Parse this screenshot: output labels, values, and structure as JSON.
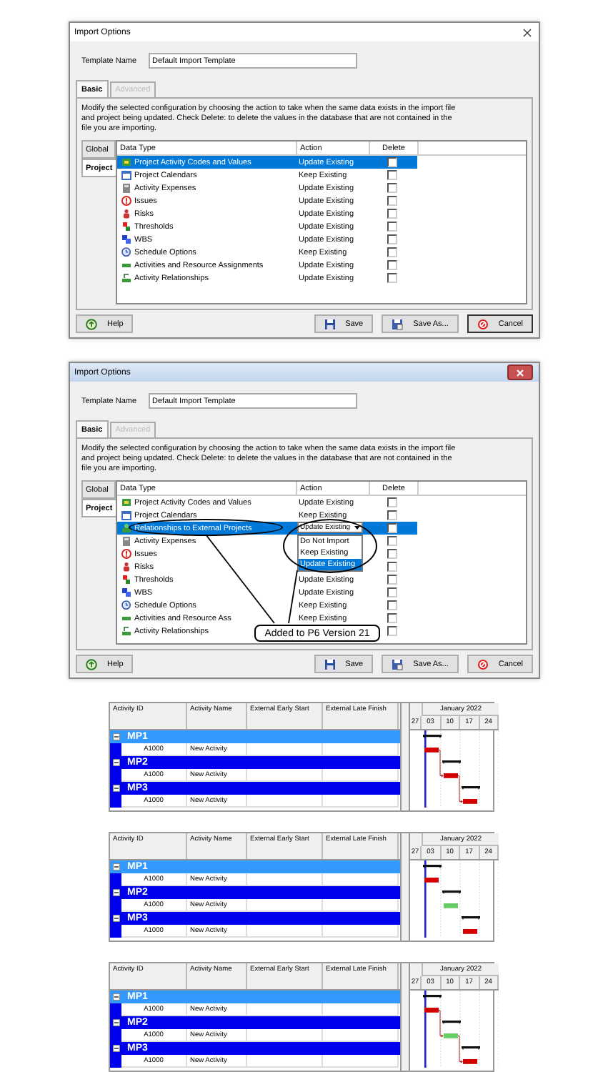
{
  "dialogs": [
    {
      "title": "Import Options",
      "kind": "win10",
      "template_label": "Template Name",
      "template_value": "Default Import Template",
      "tabs": [
        {
          "label": "Basic",
          "selected": true,
          "disabled": false
        },
        {
          "label": "Advanced",
          "selected": false,
          "disabled": true
        }
      ],
      "description": "Modify the selected configuration by choosing the action to take when the same data exists in the import file and project being updated. Check Delete: to delete the values in the database that are not contained in the file you are importing.",
      "side_tabs": [
        {
          "label": "Global",
          "selected": false
        },
        {
          "label": "Project",
          "selected": true
        }
      ],
      "columns": [
        "Data Type",
        "Action",
        "Delete"
      ],
      "rows": [
        {
          "kind": "codes",
          "name": "Project Activity Codes and Values",
          "action": "Update Existing",
          "delete": false,
          "selected": true
        },
        {
          "kind": "calendar",
          "name": "Project Calendars",
          "action": "Keep Existing",
          "delete": false,
          "selected": false
        },
        {
          "kind": "expenses",
          "name": "Activity Expenses",
          "action": "Update Existing",
          "delete": false,
          "selected": false
        },
        {
          "kind": "issues",
          "name": "Issues",
          "action": "Update Existing",
          "delete": false,
          "selected": false
        },
        {
          "kind": "risks",
          "name": "Risks",
          "action": "Update Existing",
          "delete": false,
          "selected": false
        },
        {
          "kind": "thresholds",
          "name": "Thresholds",
          "action": "Update Existing",
          "delete": false,
          "selected": false
        },
        {
          "kind": "wbs",
          "name": "WBS",
          "action": "Update Existing",
          "delete": false,
          "selected": false
        },
        {
          "kind": "schedule",
          "name": "Schedule Options",
          "action": "Keep Existing",
          "delete": false,
          "selected": false
        },
        {
          "kind": "assignments",
          "name": "Activities and Resource Assignments",
          "action": "Update Existing",
          "delete": false,
          "selected": false
        },
        {
          "kind": "relationships",
          "name": "Activity Relationships",
          "action": "Update Existing",
          "delete": false,
          "selected": false
        }
      ],
      "buttons": [
        {
          "kind": "help",
          "label": "Help",
          "default": false
        },
        {
          "kind": "save",
          "label": "Save",
          "default": false
        },
        {
          "kind": "save_as",
          "label": "Save As...",
          "default": false
        },
        {
          "kind": "cancel",
          "label": "Cancel",
          "default": true
        }
      ]
    },
    {
      "title": "Import Options",
      "kind": "win7",
      "template_label": "Template Name",
      "template_value": "Default Import Template",
      "tabs": [
        {
          "label": "Basic",
          "selected": true,
          "disabled": false
        },
        {
          "label": "Advanced",
          "selected": false,
          "disabled": true
        }
      ],
      "description": "Modify the selected configuration by choosing the action to take when the same data exists in the import file and project being updated. Check Delete: to delete the values in the database that are not contained in the file you are importing.",
      "side_tabs": [
        {
          "label": "Global",
          "selected": false
        },
        {
          "label": "Project",
          "selected": true
        }
      ],
      "columns": [
        "Data Type",
        "Action",
        "Delete"
      ],
      "rows": [
        {
          "kind": "codes",
          "name": "Project Activity Codes and Values",
          "action": "Update Existing",
          "delete": false,
          "selected": false
        },
        {
          "kind": "calendar",
          "name": "Project Calendars",
          "action": "Keep Existing",
          "delete": false,
          "selected": false
        },
        {
          "kind": "external",
          "name": "Relationships to External Projects",
          "delete": false,
          "selected": true,
          "circled": true,
          "dropdown": {
            "value": "Update Existing",
            "circled": true,
            "options": [
              {
                "label": "Do Not Import",
                "selected": false
              },
              {
                "label": "Keep Existing",
                "selected": false
              },
              {
                "label": "Update Existing",
                "selected": true
              }
            ]
          }
        },
        {
          "kind": "expenses",
          "name": "Activity Expenses",
          "delete": false,
          "selected": false
        },
        {
          "kind": "issues",
          "name": "Issues",
          "delete": false,
          "selected": false
        },
        {
          "kind": "risks",
          "name": "Risks",
          "delete": false,
          "selected": false
        },
        {
          "kind": "thresholds",
          "name": "Thresholds",
          "action": "Update Existing",
          "delete": false,
          "selected": false
        },
        {
          "kind": "wbs",
          "name": "WBS",
          "action": "Update Existing",
          "delete": false,
          "selected": false
        },
        {
          "kind": "schedule",
          "name": "Schedule Options",
          "action": "Keep Existing",
          "delete": false,
          "selected": false
        },
        {
          "kind": "assignments",
          "name": "Activities and Resource Ass",
          "action": "Keep Existing",
          "delete": false,
          "selected": false
        },
        {
          "kind": "relationships",
          "name": "Activity Relationships",
          "delete": false,
          "selected": false
        }
      ],
      "callout": {
        "text": "Added to P6 Version 21"
      },
      "buttons": [
        {
          "kind": "help",
          "label": "Help",
          "default": false
        },
        {
          "kind": "save",
          "label": "Save",
          "default": false
        },
        {
          "kind": "save_as",
          "label": "Save As...",
          "default": false
        },
        {
          "kind": "cancel",
          "label": "Cancel",
          "default": false
        }
      ]
    }
  ],
  "gantt_views": [
    {
      "columns": [
        "Activity ID",
        "Activity Name",
        "External Early Start",
        "External Late Finish"
      ],
      "timescale": {
        "month": "January 2022",
        "days": [
          "27",
          "03",
          "10",
          "17",
          "24"
        ]
      },
      "relationships_shown": true,
      "rows": [
        {
          "kind": "group",
          "label": "MP1",
          "selected": true,
          "expanded": true
        },
        {
          "kind": "activity",
          "id": "A1000",
          "name": "New Activity",
          "color": "#d40000"
        },
        {
          "kind": "group",
          "label": "MP2",
          "selected": false,
          "expanded": true
        },
        {
          "kind": "activity",
          "id": "A1000",
          "name": "New Activity",
          "color": "#d40000"
        },
        {
          "kind": "group",
          "label": "MP3",
          "selected": false,
          "expanded": true
        },
        {
          "kind": "activity",
          "id": "A1000",
          "name": "New Activity",
          "color": "#d40000"
        }
      ]
    },
    {
      "columns": [
        "Activity ID",
        "Activity Name",
        "External Early Start",
        "External Late Finish"
      ],
      "timescale": {
        "month": "January 2022",
        "days": [
          "27",
          "03",
          "10",
          "17",
          "24"
        ]
      },
      "relationships_shown": false,
      "rows": [
        {
          "kind": "group",
          "label": "MP1",
          "selected": true,
          "expanded": true
        },
        {
          "kind": "activity",
          "id": "A1000",
          "name": "New Activity",
          "color": "#d40000"
        },
        {
          "kind": "group",
          "label": "MP2",
          "selected": false,
          "expanded": true
        },
        {
          "kind": "activity",
          "id": "A1000",
          "name": "New Activity",
          "color": "#66cc66"
        },
        {
          "kind": "group",
          "label": "MP3",
          "selected": false,
          "expanded": true
        },
        {
          "kind": "activity",
          "id": "A1000",
          "name": "New Activity",
          "color": "#d40000"
        }
      ]
    },
    {
      "columns": [
        "Activity ID",
        "Activity Name",
        "External Early Start",
        "External Late Finish"
      ],
      "timescale": {
        "month": "January 2022",
        "days": [
          "27",
          "03",
          "10",
          "17",
          "24"
        ]
      },
      "relationships_shown": true,
      "rows": [
        {
          "kind": "group",
          "label": "MP1",
          "selected": true,
          "expanded": true
        },
        {
          "kind": "activity",
          "id": "A1000",
          "name": "New Activity",
          "color": "#d40000"
        },
        {
          "kind": "group",
          "label": "MP2",
          "selected": false,
          "expanded": true
        },
        {
          "kind": "activity",
          "id": "A1000",
          "name": "New Activity",
          "color": "#66cc66"
        },
        {
          "kind": "group",
          "label": "MP3",
          "selected": false,
          "expanded": true
        },
        {
          "kind": "activity",
          "id": "A1000",
          "name": "New Activity",
          "color": "#d40000"
        }
      ]
    }
  ]
}
